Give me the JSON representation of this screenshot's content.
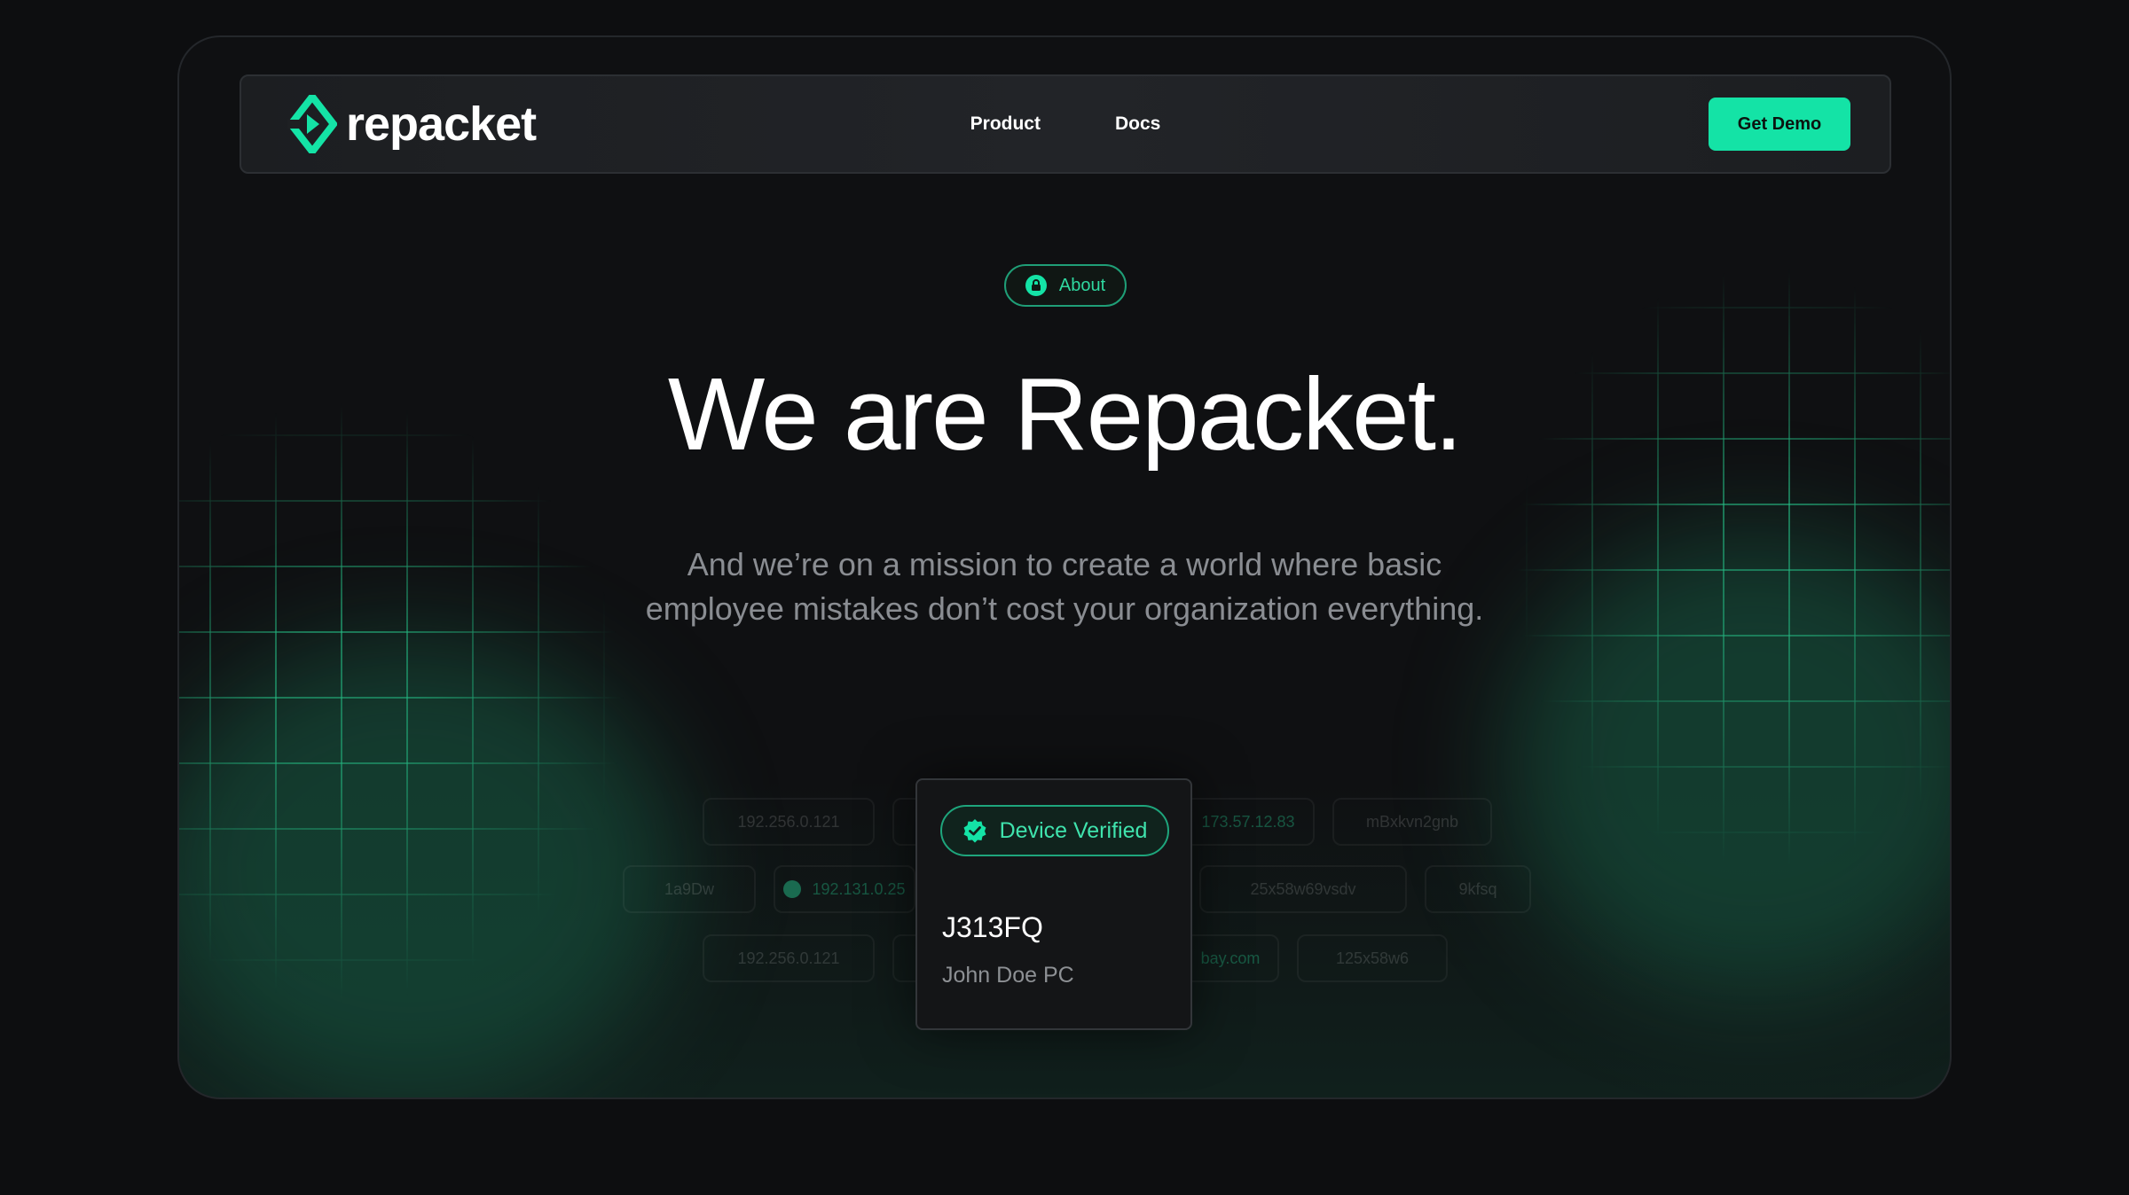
{
  "brand": {
    "name": "repacket",
    "accent": "#14e3a6"
  },
  "nav": {
    "links": [
      {
        "label": "Product"
      },
      {
        "label": "Docs"
      }
    ],
    "cta_label": "Get Demo"
  },
  "hero": {
    "badge_label": "About",
    "title": "We are Repacket.",
    "subtitle_line1": "And we’re on a mission to create a world where basic",
    "subtitle_line2": "employee mistakes don’t cost your organization everything."
  },
  "background_chips": [
    {
      "text": "192.256.0.121"
    },
    {
      "text": "173.57.12.83"
    },
    {
      "text": "mBxkvn2gnb"
    },
    {
      "text": "1a9Dw"
    },
    {
      "text": "192.131.0.25"
    },
    {
      "text": "25x58w69vsdv"
    },
    {
      "text": "9kfsq"
    },
    {
      "text": "192.256.0.121"
    },
    {
      "text": "bay.com"
    },
    {
      "text": "125x58w6"
    }
  ],
  "device_card": {
    "status": "Device Verified",
    "device_id": "J313FQ",
    "owner": "John Doe PC"
  }
}
